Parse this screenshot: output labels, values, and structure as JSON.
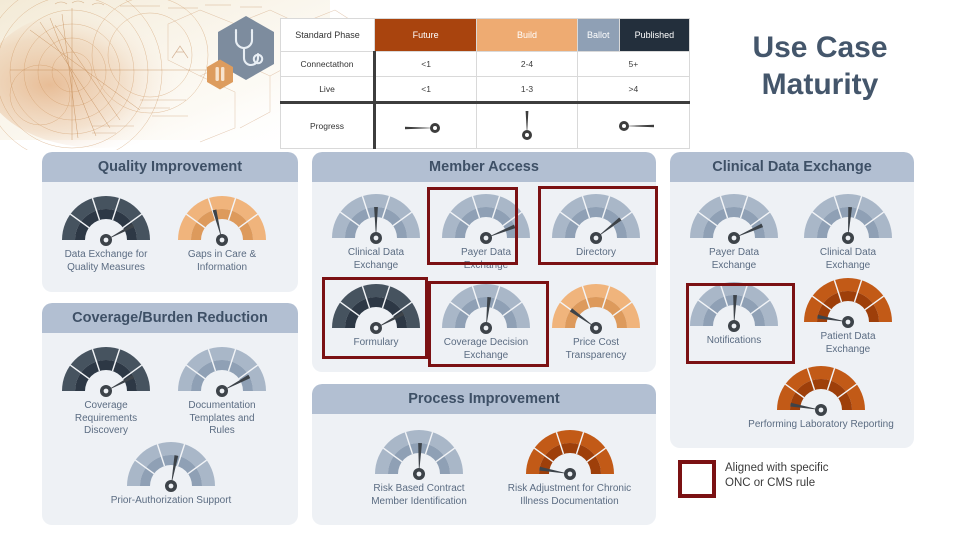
{
  "title": "Use Case\nMaturity",
  "title_line1": "Use Case",
  "title_line2": "Maturity",
  "colors": {
    "future": "#a9440e",
    "build": "#eeab72",
    "ballot": "#8fa0b5",
    "published": "#232f3c",
    "panel_head": "#b2bfd2",
    "panel_body": "#eef1f5",
    "highlight": "#7b1113",
    "label_text": "#5b6c82",
    "title_text": "#44566b"
  },
  "legend_table": {
    "header_row_label": "Standard Phase",
    "phases": [
      "Future",
      "Build",
      "Ballot",
      "Published"
    ],
    "rows": [
      {
        "label": "Connectathon",
        "values": [
          "<1",
          "2-4",
          "5+"
        ]
      },
      {
        "label": "Live",
        "values": [
          "<1",
          "1-3",
          ">4"
        ]
      }
    ],
    "progress_label": "Progress",
    "progress_needles": [
      -90,
      0,
      90
    ]
  },
  "panels": [
    {
      "id": "quality-improvement",
      "title": "Quality Improvement",
      "tiles": [
        {
          "label": "Data Exchange for\nQuality Measures",
          "phase": "published",
          "needle": 62,
          "highlight": false
        },
        {
          "label": "Gaps in Care &\nInformation",
          "phase": "build",
          "needle": -14,
          "highlight": false
        }
      ]
    },
    {
      "id": "coverage-burden-reduction",
      "title": "Coverage/Burden Reduction",
      "tiles": [
        {
          "label": "Coverage\nRequirements\nDiscovery",
          "phase": "published",
          "needle": 62,
          "highlight": false
        },
        {
          "label": "Documentation\nTemplates and\nRules",
          "phase": "ballot",
          "needle": 62,
          "highlight": false
        },
        {
          "label": "Prior-Authorization Support",
          "phase": "ballot",
          "needle": 10,
          "highlight": false
        }
      ]
    },
    {
      "id": "member-access",
      "title": "Member Access",
      "tiles": [
        {
          "label": "Clinical Data\nExchange",
          "phase": "ballot",
          "needle": 0,
          "highlight": false
        },
        {
          "label": "Payer Data\nExchange",
          "phase": "ballot",
          "needle": 68,
          "highlight": true
        },
        {
          "label": "Directory",
          "phase": "ballot",
          "needle": 52,
          "highlight": true
        },
        {
          "label": "Formulary",
          "phase": "published",
          "needle": 62,
          "highlight": true
        },
        {
          "label": "Coverage Decision\nExchange",
          "phase": "ballot",
          "needle": 6,
          "highlight": true
        },
        {
          "label": "Price Cost\nTransparency",
          "phase": "build",
          "needle": -54,
          "highlight": false
        }
      ]
    },
    {
      "id": "process-improvement",
      "title": "Process Improvement",
      "tiles": [
        {
          "label": "Risk Based Contract\nMember Identification",
          "phase": "ballot",
          "needle": 2,
          "highlight": false
        },
        {
          "label": "Risk Adjustment for Chronic\nIllness Documentation",
          "phase": "future",
          "needle": -80,
          "highlight": false
        }
      ]
    },
    {
      "id": "clinical-data-exchange",
      "title": "Clinical Data Exchange",
      "tiles": [
        {
          "label": "Payer Data\nExchange",
          "phase": "ballot",
          "needle": 66,
          "highlight": false
        },
        {
          "label": "Clinical Data\nExchange",
          "phase": "ballot",
          "needle": 4,
          "highlight": false
        },
        {
          "label": "Notifications",
          "phase": "ballot",
          "needle": 2,
          "highlight": true
        },
        {
          "label": "Patient Data\nExchange",
          "phase": "future",
          "needle": -80,
          "highlight": false
        },
        {
          "label": "Performing Laboratory Reporting",
          "phase": "future",
          "needle": -80,
          "highlight": false
        }
      ]
    }
  ],
  "key": {
    "line1": "Aligned with specific",
    "line2": "ONC or CMS rule"
  },
  "icons": {
    "hexagon_large": "stethoscope-icon",
    "hexagon_small": "test-tube-icon"
  }
}
